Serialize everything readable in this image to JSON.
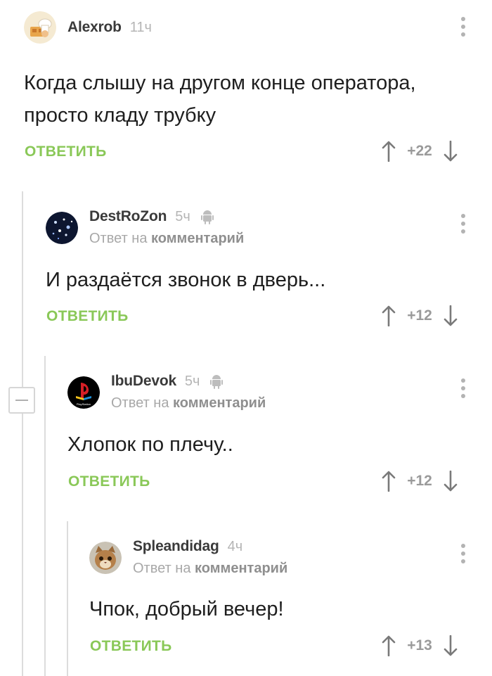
{
  "comments": [
    {
      "author": "Alexrob",
      "time": "11ч",
      "reply_to": null,
      "platform_icon": null,
      "text_lines": [
        "Когда слышу на другом конце оператора,",
        "просто кладу трубку"
      ],
      "reply_label": "ОТВЕТИТЬ",
      "score": "+22",
      "avatar": "chef-avatar"
    },
    {
      "author": "DestRoZon",
      "time": "5ч",
      "platform_icon": "android-icon",
      "reply_to": {
        "prefix": "Ответ на",
        "link": "комментарий"
      },
      "text_lines": [
        "И раздаётся звонок в дверь..."
      ],
      "reply_label": "ОТВЕТИТЬ",
      "score": "+12",
      "avatar": "galaxy-avatar"
    },
    {
      "author": "IbuDevok",
      "time": "5ч",
      "platform_icon": "android-icon",
      "reply_to": {
        "prefix": "Ответ на",
        "link": "комментарий"
      },
      "text_lines": [
        "Хлопок по плечу.."
      ],
      "reply_label": "ОТВЕТИТЬ",
      "score": "+12",
      "avatar": "playstation-avatar",
      "avatar_caption": "PlayStation"
    },
    {
      "author": "Spleandidag",
      "time": "4ч",
      "platform_icon": null,
      "reply_to": {
        "prefix": "Ответ на",
        "link": "комментарий"
      },
      "text_lines": [
        "Чпок, добрый вечер!"
      ],
      "reply_label": "ОТВЕТИТЬ",
      "score": "+13",
      "avatar": "cat-avatar"
    }
  ],
  "colors": {
    "reply_green": "#8ac858",
    "thread_line": "#dcdcdc",
    "muted_text": "#a8a8a8"
  }
}
